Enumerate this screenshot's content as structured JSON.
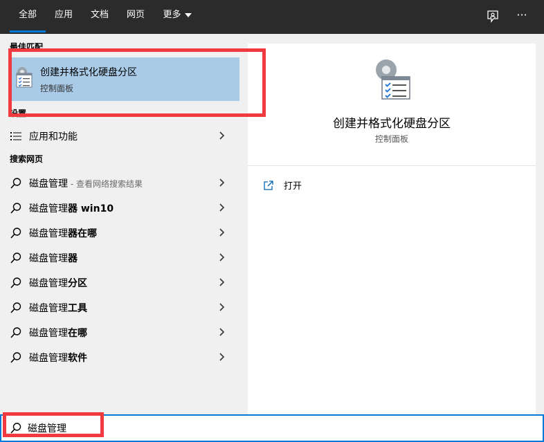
{
  "tabs": [
    {
      "label": "全部"
    },
    {
      "label": "应用"
    },
    {
      "label": "文档"
    },
    {
      "label": "网页"
    },
    {
      "label": "更多"
    }
  ],
  "icons": {
    "feedback": "feedback-icon",
    "more": "more-options-icon",
    "search": "search-icon",
    "chevron": "chevron-right-icon"
  },
  "more_options_glyph": "···",
  "best_match": {
    "header": "最佳匹配",
    "title": "创建并格式化硬盘分区",
    "subtitle": "控制面板"
  },
  "settings": {
    "header": "设置",
    "items": [
      {
        "label": "应用和功能"
      }
    ]
  },
  "web_search": {
    "header": "搜索网页",
    "items": [
      {
        "query": "磁盘管理",
        "bold_suffix": "",
        "hint": " - 查看网络搜索结果"
      },
      {
        "query": "磁盘管理",
        "bold_suffix": "器 win10",
        "hint": ""
      },
      {
        "query": "磁盘管理",
        "bold_suffix": "器在哪",
        "hint": ""
      },
      {
        "query": "磁盘管理",
        "bold_suffix": "器",
        "hint": ""
      },
      {
        "query": "磁盘管理",
        "bold_suffix": "分区",
        "hint": ""
      },
      {
        "query": "磁盘管理",
        "bold_suffix": "工具",
        "hint": ""
      },
      {
        "query": "磁盘管理",
        "bold_suffix": "在哪",
        "hint": ""
      },
      {
        "query": "磁盘管理",
        "bold_suffix": "软件",
        "hint": ""
      }
    ]
  },
  "preview": {
    "title": "创建并格式化硬盘分区",
    "subtitle": "控制面板",
    "actions": [
      {
        "label": "打开",
        "icon": "open-icon"
      }
    ]
  },
  "search": {
    "value": "磁盘管理"
  },
  "colors": {
    "topbar": "#2b2b2b",
    "accent": "#0078d7",
    "selected": "#a9cbe8",
    "annotation": "#f03a3f"
  }
}
